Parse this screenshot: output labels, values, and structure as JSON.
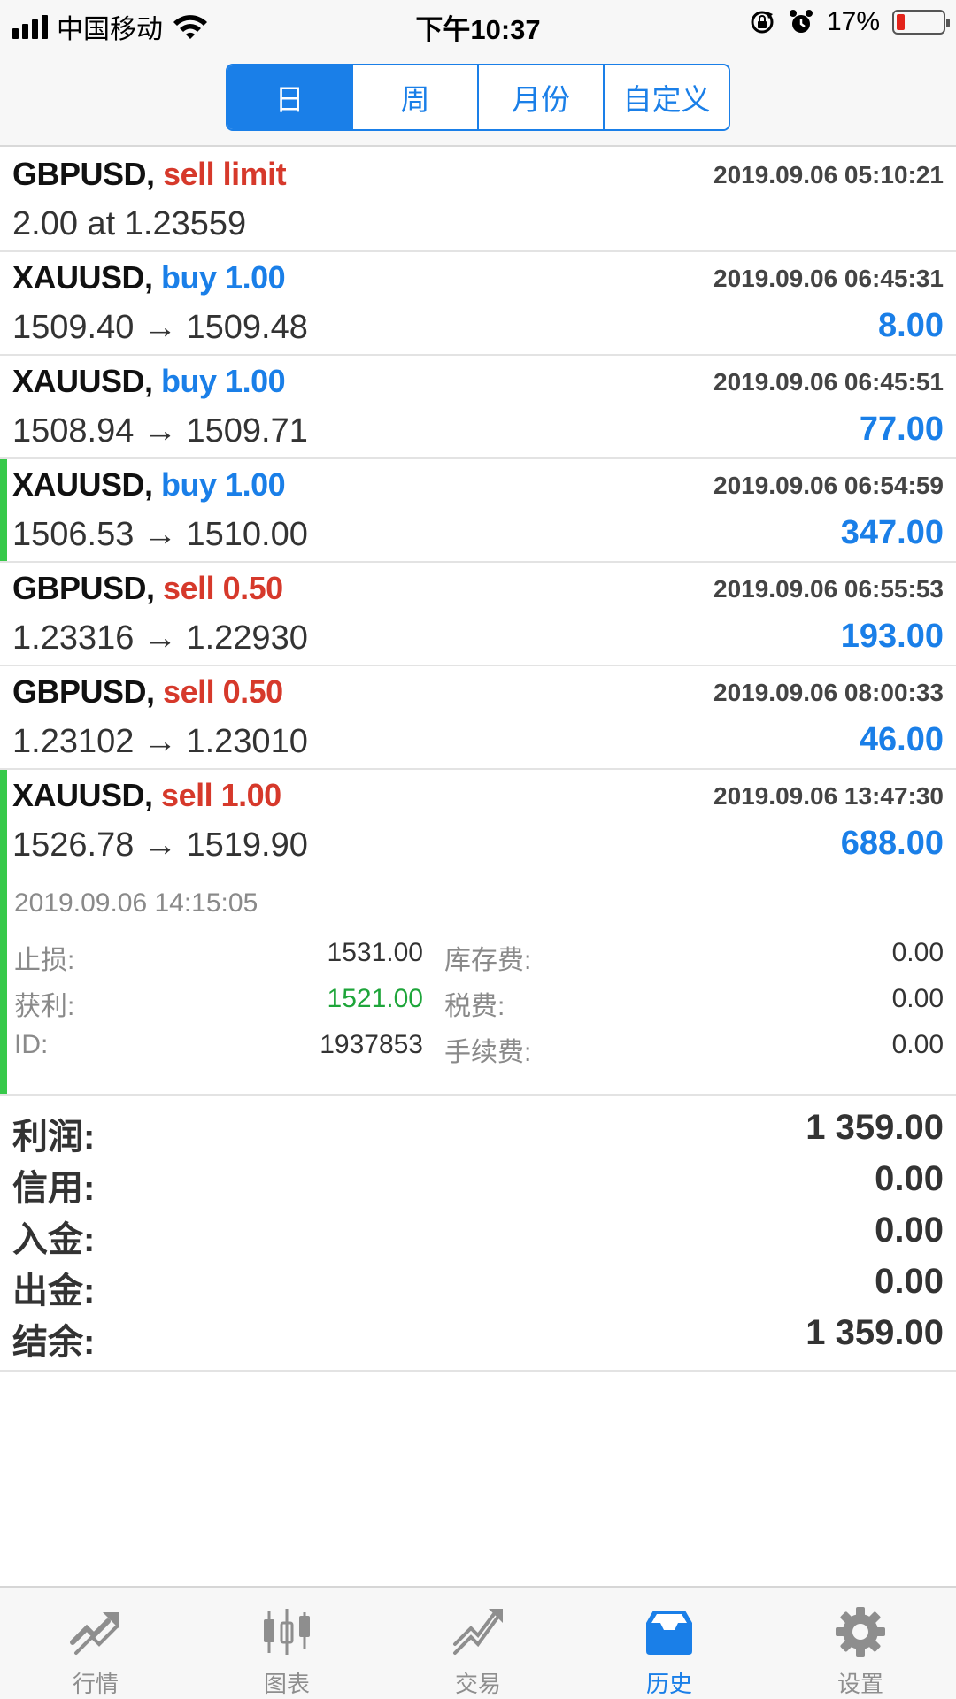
{
  "status_bar": {
    "carrier": "中国移动",
    "time": "下午10:37",
    "battery_percent": "17%",
    "battery_level": 0.17,
    "icons": [
      "signal-icon",
      "wifi-icon",
      "orientation-lock-icon",
      "alarm-icon",
      "battery-icon"
    ]
  },
  "segment": {
    "tabs": [
      {
        "label": "日",
        "active": true
      },
      {
        "label": "周",
        "active": false
      },
      {
        "label": "月份",
        "active": false
      },
      {
        "label": "自定义",
        "active": false
      }
    ]
  },
  "orders": [
    {
      "symbol": "GBPUSD,",
      "direction": "sell limit",
      "side": "sell",
      "time": "2019.09.06 05:10:21",
      "line2": "2.00 at 1.23559",
      "profit": ""
    },
    {
      "symbol": "XAUUSD,",
      "direction": "buy 1.00",
      "side": "buy",
      "time": "2019.09.06 06:45:31",
      "line2": "1509.40 → 1509.48",
      "profit": "8.00"
    },
    {
      "symbol": "XAUUSD,",
      "direction": "buy 1.00",
      "side": "buy",
      "time": "2019.09.06 06:45:51",
      "line2": "1508.94 → 1509.71",
      "profit": "77.00"
    },
    {
      "symbol": "XAUUSD,",
      "direction": "buy 1.00",
      "side": "buy",
      "time": "2019.09.06 06:54:59",
      "line2": "1506.53 → 1510.00",
      "profit": "347.00",
      "marked": true
    },
    {
      "symbol": "GBPUSD,",
      "direction": "sell 0.50",
      "side": "sell",
      "time": "2019.09.06 06:55:53",
      "line2": "1.23316 → 1.22930",
      "profit": "193.00"
    },
    {
      "symbol": "GBPUSD,",
      "direction": "sell 0.50",
      "side": "sell",
      "time": "2019.09.06 08:00:33",
      "line2": "1.23102 → 1.23010",
      "profit": "46.00"
    },
    {
      "symbol": "XAUUSD,",
      "direction": "sell 1.00",
      "side": "sell",
      "time": "2019.09.06 13:47:30",
      "line2": "1526.78 → 1519.90",
      "profit": "688.00",
      "marked": true
    }
  ],
  "expanded_detail": {
    "close_time": "2019.09.06 14:15:05",
    "rows": [
      {
        "label": "止损:",
        "value": "1531.00",
        "label2": "库存费:",
        "value2": "0.00"
      },
      {
        "label": "获利:",
        "value": "1521.00",
        "label2": "税费:",
        "value2": "0.00",
        "value_color": "#1ea53a"
      },
      {
        "label": "ID:",
        "value": "1937853",
        "label2": "手续费:",
        "value2": "0.00"
      }
    ]
  },
  "summary": [
    {
      "label": "利润:",
      "value": "1 359.00"
    },
    {
      "label": "信用:",
      "value": "0.00"
    },
    {
      "label": "入金:",
      "value": "0.00"
    },
    {
      "label": "出金:",
      "value": "0.00"
    },
    {
      "label": "结余:",
      "value": "1 359.00"
    }
  ],
  "tabbar": {
    "items": [
      {
        "label": "行情",
        "icon": "quotes-icon",
        "active": false
      },
      {
        "label": "图表",
        "icon": "chart-icon",
        "active": false
      },
      {
        "label": "交易",
        "icon": "trade-icon",
        "active": false
      },
      {
        "label": "历史",
        "icon": "history-icon",
        "active": true
      },
      {
        "label": "设置",
        "icon": "settings-icon",
        "active": false
      }
    ]
  },
  "colors": {
    "accent": "#1a7fe8",
    "sell": "#d6392b",
    "buy": "#1a7fe8",
    "marker": "#37c94a",
    "take_profit": "#1ea53a",
    "battery_low": "#e3241b"
  }
}
